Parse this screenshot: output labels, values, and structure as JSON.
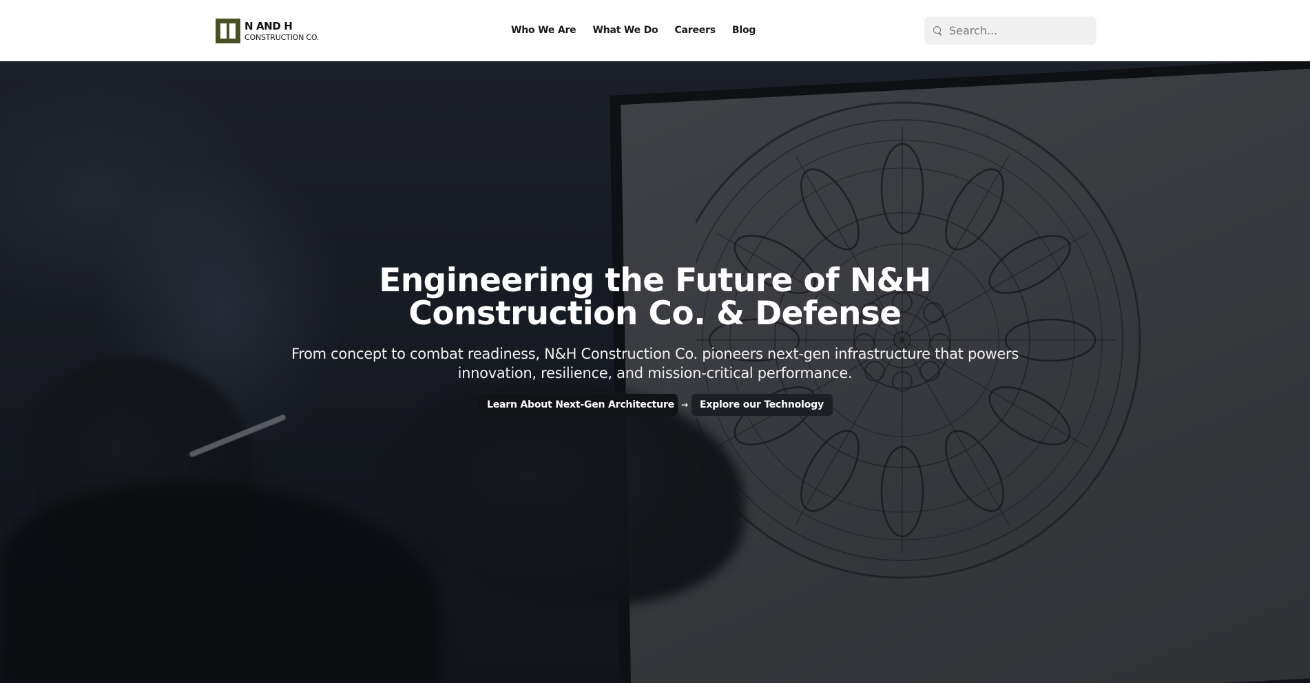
{
  "header": {
    "logo": {
      "line1": "N AND H",
      "line2": "CONSTRUCTION CO."
    },
    "nav": [
      {
        "label": "Who We Are"
      },
      {
        "label": "What We Do"
      },
      {
        "label": "Careers"
      },
      {
        "label": "Blog"
      }
    ],
    "search": {
      "placeholder": "Search...",
      "icon": "search-icon"
    }
  },
  "hero": {
    "title": "Engineering the Future of N&H Construction Co. & Defense",
    "subtitle": "From concept to combat readiness, N&H Construction Co. pioneers next-gen infrastructure that powers innovation, resilience, and mission-critical performance.",
    "primary_cta": {
      "label": "Learn About Next-Gen Architecture",
      "icon": "arrow-right-icon",
      "icon_glyph": "→"
    },
    "secondary_cta": {
      "label": "Explore our Technology"
    }
  },
  "colors": {
    "brand_olive": "#4a4f24",
    "button_dark": "#111316",
    "search_bg": "#f0f0f0"
  }
}
